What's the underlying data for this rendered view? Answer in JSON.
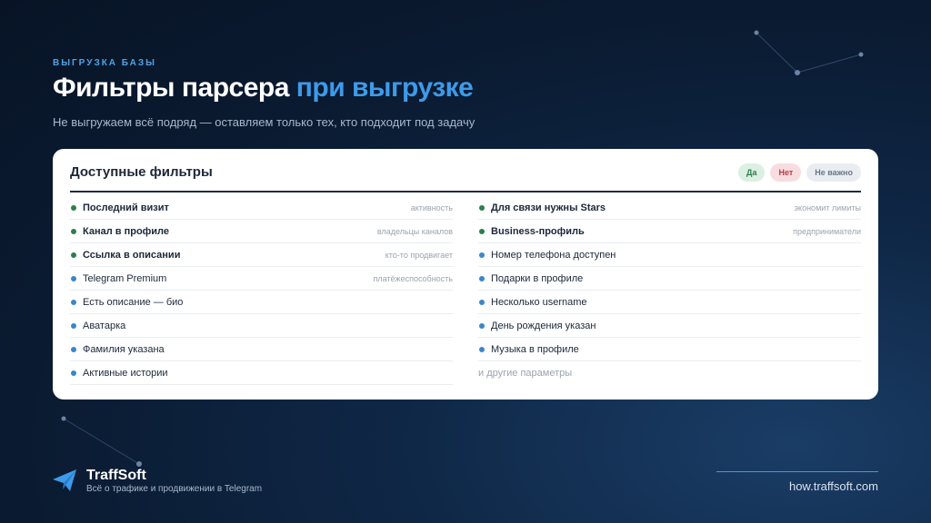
{
  "header": {
    "eyebrow": "ВЫГРУЗКА БАЗЫ",
    "title_main": "Фильтры парсера",
    "title_accent": "при выгрузке",
    "subtitle": "Не выгружаем всё подряд — оставляем только тех, кто подходит под задачу"
  },
  "card": {
    "title": "Доступные фильтры",
    "badges": {
      "yes": "Да",
      "no": "Нет",
      "any": "Не важно"
    },
    "left": [
      {
        "label": "Последний визит",
        "hint": "активность"
      },
      {
        "label": "Канал в профиле",
        "hint": "владельцы каналов"
      },
      {
        "label": "Ссылка в описании",
        "hint": "кто-то продвигает"
      },
      {
        "label": "Telegram Premium",
        "hint": "платёжеспособность"
      },
      {
        "label": "Есть описание — био"
      },
      {
        "label": "Аватарка"
      },
      {
        "label": "Фамилия указана"
      },
      {
        "label": "Активные истории"
      }
    ],
    "right": [
      {
        "label": "Для связи нужны Stars",
        "hint": "экономит лимиты"
      },
      {
        "label": "Business-профиль",
        "hint": "предприниматели"
      },
      {
        "label": "Номер телефона доступен"
      },
      {
        "label": "Подарки в профиле"
      },
      {
        "label": "Несколько username"
      },
      {
        "label": "День рождения указан"
      },
      {
        "label": "Музыка в профиле"
      }
    ],
    "more": "и другие параметры"
  },
  "footer": {
    "brand": "TraffSoft",
    "tagline": "Всё о трафике и продвижении в Telegram",
    "website": "how.traffsoft.com"
  },
  "colors": {
    "accent": "#3d9be9",
    "yes": "#2e7d4f",
    "no": "#c0394b",
    "info": "#3a86c9"
  },
  "icons": {
    "logo": "paper-plane-icon"
  }
}
